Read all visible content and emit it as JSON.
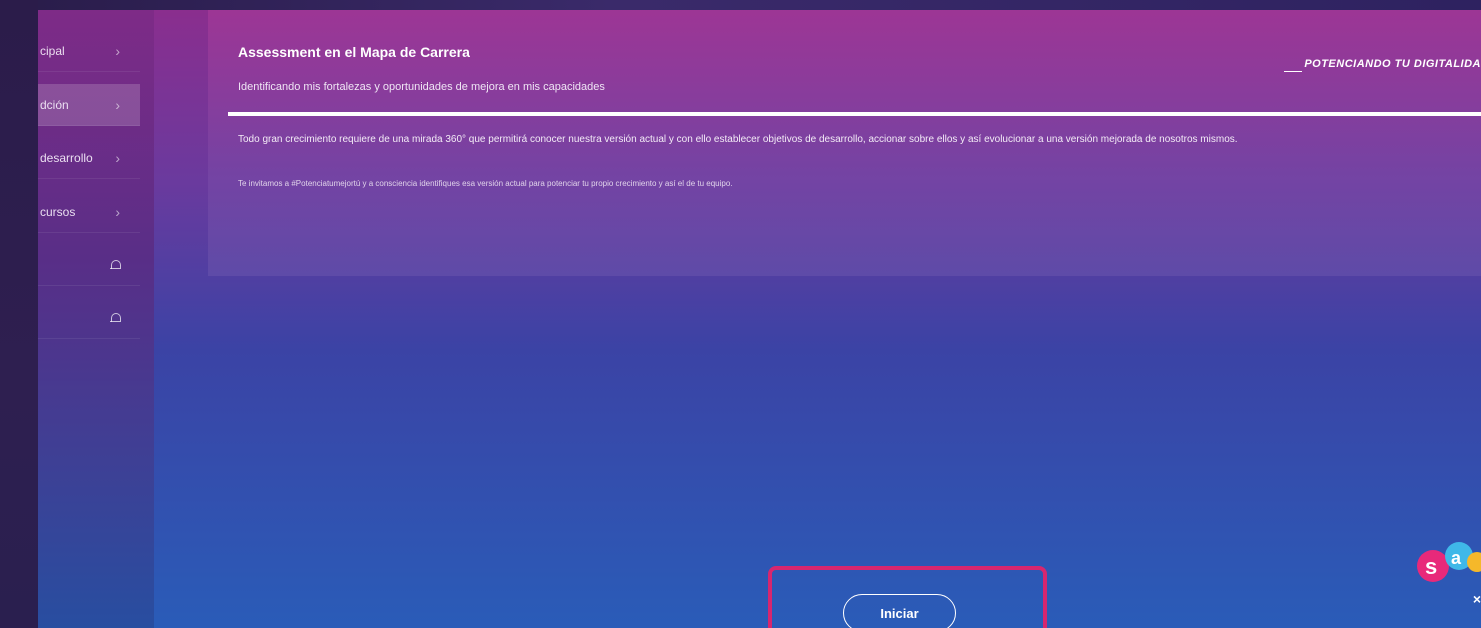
{
  "sidebar": {
    "items": [
      {
        "label": "cipal",
        "icon": "chevron-right-icon",
        "active": false,
        "faded": false
      },
      {
        "label": "dción",
        "icon": "chevron-right-icon",
        "active": true,
        "faded": false
      },
      {
        "label": "desarrollo",
        "icon": "chevron-right-icon",
        "active": false,
        "faded": false
      },
      {
        "label": "cursos",
        "icon": "chevron-right-icon",
        "active": false,
        "faded": false
      },
      {
        "label": "",
        "icon": "bell-icon",
        "active": false,
        "faded": true
      },
      {
        "label": "",
        "icon": "bell-icon",
        "active": false,
        "faded": true
      }
    ]
  },
  "panel": {
    "title": "Assessment en el Mapa de Carrera",
    "subtitle": "Identificando mis fortalezas y oportunidades de mejora en mis capacidades",
    "brand_tag": "POTENCIANDO TU DIGITALIDA",
    "paragraph_1": "Todo gran crecimiento requiere de una mirada 360° que permitirá conocer nuestra versión actual y con ello establecer objetivos de desarrollo, accionar sobre ellos y así evolucionar a una versión mejorada de nosotros mismos.",
    "paragraph_2": "Te invitamos a #Potenciatumejortú y a consciencia identifiques esa versión actual para potenciar tu propio crecimiento y así el de tu equipo."
  },
  "actions": {
    "start_label": "Iniciar"
  },
  "close_glyph": "×",
  "colors": {
    "highlight": "#d7266f",
    "gradient_top": "#8a2e8e",
    "gradient_bottom": "#2a5cb8"
  }
}
